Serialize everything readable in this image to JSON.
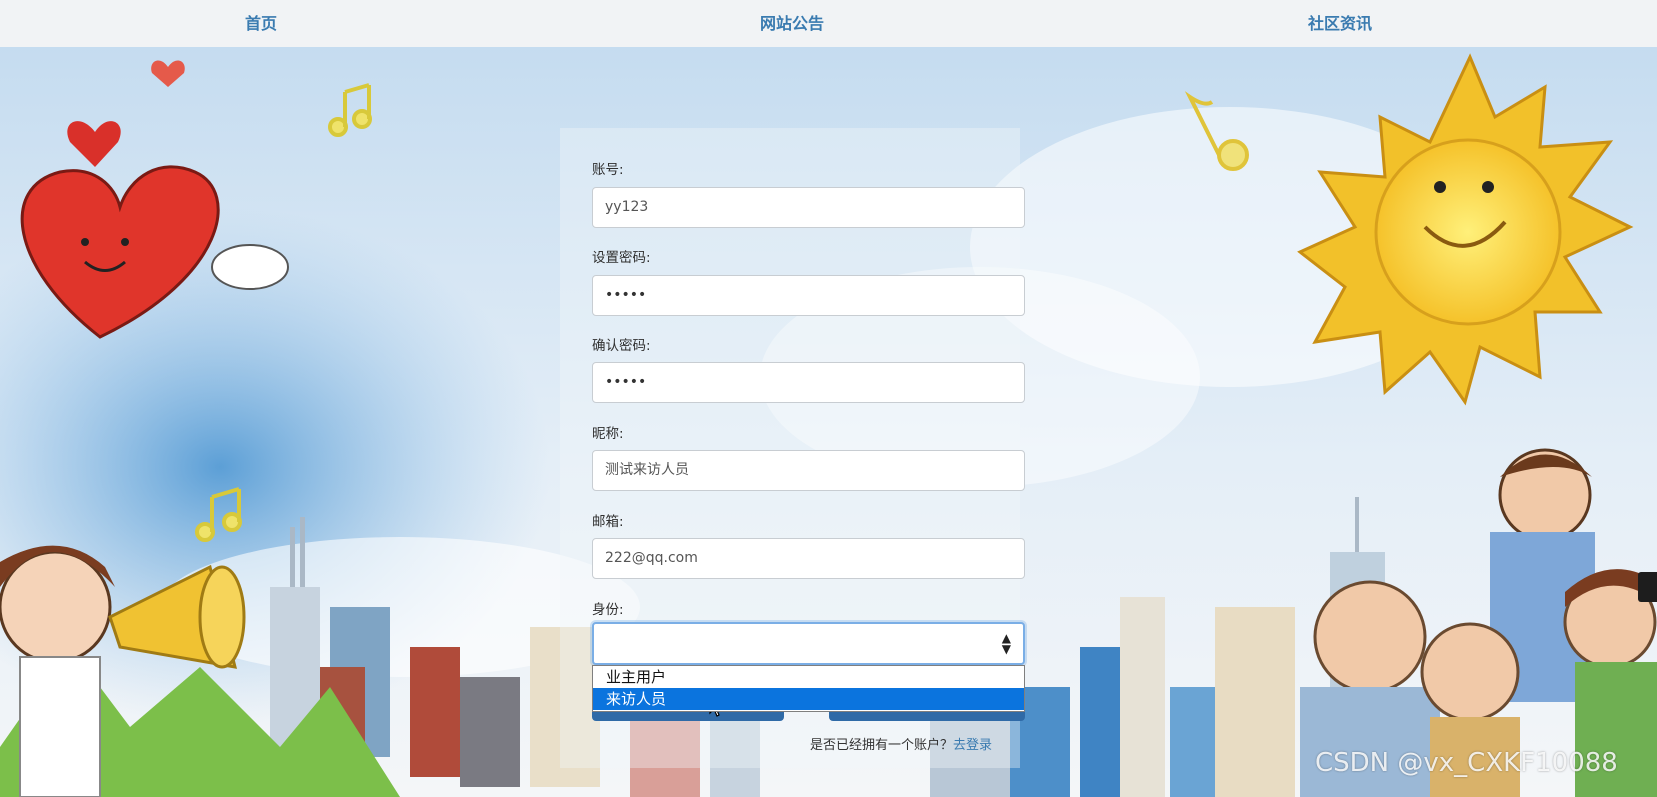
{
  "nav": {
    "items": [
      {
        "label": "首页"
      },
      {
        "label": "网站公告"
      },
      {
        "label": "社区资讯"
      }
    ]
  },
  "form": {
    "account_label": "账号:",
    "account_value": "yy123",
    "password_label": "设置密码:",
    "password_value": "•••••",
    "confirm_label": "确认密码:",
    "confirm_value": "•••••",
    "nickname_label": "昵称:",
    "nickname_value": "测试来访人员",
    "email_label": "邮箱:",
    "email_value": "222@qq.com",
    "identity_label": "身份:",
    "identity_value": "",
    "identity_options": [
      "业主用户",
      "来访人员"
    ],
    "identity_highlighted": "来访人员",
    "login_prompt": "是否已经拥有一个账户？",
    "login_link": "去登录"
  },
  "watermark": "CSDN @vx_CXKF10088",
  "colors": {
    "nav_text": "#3a7bb0",
    "option_highlight": "#0b74de",
    "button": "#2f6aa7"
  }
}
